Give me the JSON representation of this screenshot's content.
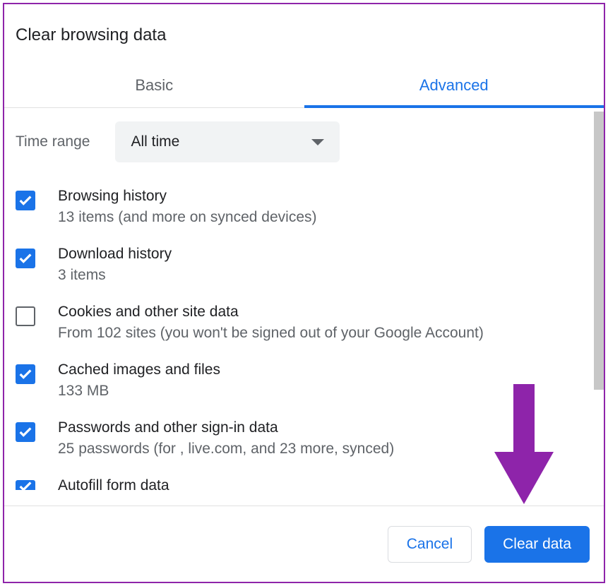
{
  "dialog": {
    "title": "Clear browsing data"
  },
  "tabs": {
    "basic": "Basic",
    "advanced": "Advanced"
  },
  "time": {
    "label": "Time range",
    "selected": "All time"
  },
  "items": [
    {
      "checked": true,
      "title": "Browsing history",
      "sub": "13 items (and more on synced devices)"
    },
    {
      "checked": true,
      "title": "Download history",
      "sub": "3 items"
    },
    {
      "checked": false,
      "title": "Cookies and other site data",
      "sub": "From 102 sites (you won't be signed out of your Google Account)"
    },
    {
      "checked": true,
      "title": "Cached images and files",
      "sub": "133 MB"
    },
    {
      "checked": true,
      "title": "Passwords and other sign-in data",
      "sub": "25 passwords (for , live.com, and 23 more, synced)"
    },
    {
      "checked": true,
      "title": "Autofill form data",
      "sub": ""
    }
  ],
  "buttons": {
    "cancel": "Cancel",
    "clear": "Clear data"
  },
  "annotation": {
    "arrow_color": "#8e24aa"
  }
}
